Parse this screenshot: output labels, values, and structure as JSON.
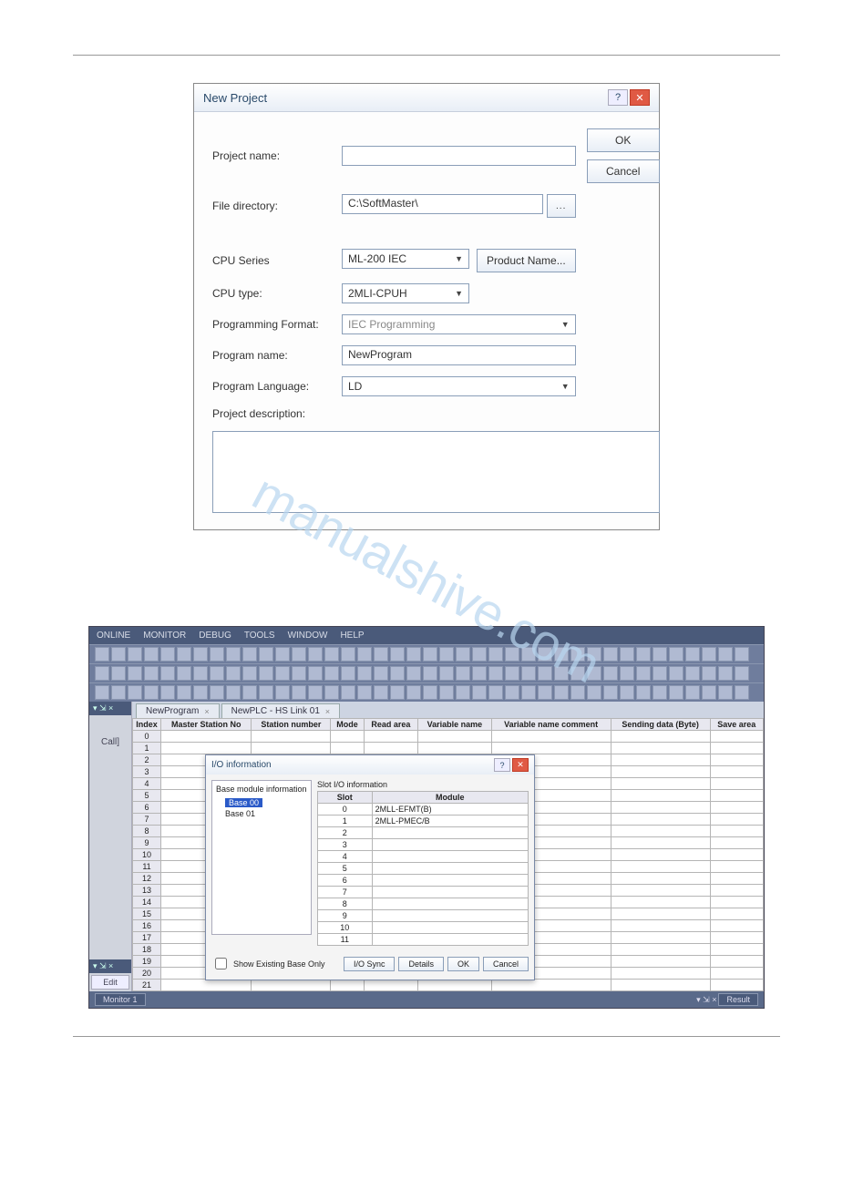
{
  "new_project": {
    "title": "New Project",
    "labels": {
      "project_name": "Project name:",
      "file_directory": "File directory:",
      "cpu_series": "CPU Series",
      "cpu_type": "CPU type:",
      "programming_format": "Programming Format:",
      "program_name": "Program name:",
      "program_language": "Program Language:",
      "project_description": "Project description:"
    },
    "values": {
      "project_name": "",
      "file_directory": "C:\\SoftMaster\\",
      "cpu_series": "ML-200 IEC",
      "cpu_type": "2MLI-CPUH",
      "programming_format": "IEC Programming",
      "program_name": "NewProgram",
      "program_language": "LD",
      "project_description": ""
    },
    "buttons": {
      "ok": "OK",
      "cancel": "Cancel",
      "product_name": "Product Name...",
      "browse": "..."
    }
  },
  "watermark": "manualshive.com",
  "app": {
    "menus": [
      "ONLINE",
      "MONITOR",
      "DEBUG",
      "TOOLS",
      "WINDOW",
      "HELP"
    ],
    "tabs": [
      {
        "label": "NewProgram"
      },
      {
        "label": "NewPLC - HS Link 01"
      }
    ],
    "side_panel_pin": "▾ ⇲ ×",
    "side_edit": "Edit",
    "call_label": "Call]",
    "grid_headers": [
      "Index",
      "Master Station No",
      "Station number",
      "Mode",
      "Read area",
      "Variable name",
      "Variable name comment",
      "Sending data (Byte)",
      "Save area"
    ],
    "grid_rows": [
      "0",
      "1",
      "2",
      "3",
      "4",
      "5",
      "6",
      "7",
      "8",
      "9",
      "10",
      "11",
      "12",
      "13",
      "14",
      "15",
      "16",
      "17",
      "18",
      "19",
      "20",
      "21"
    ],
    "io_dialog": {
      "title": "I/O information",
      "base_label": "Base module information",
      "slot_label": "Slot I/O information",
      "tree": [
        {
          "label": "Base 00",
          "selected": true
        },
        {
          "label": "Base 01",
          "selected": false
        }
      ],
      "slot_headers": [
        "Slot",
        "Module"
      ],
      "slot_rows": [
        {
          "slot": "0",
          "module": "2MLL-EFMT(B)"
        },
        {
          "slot": "1",
          "module": "2MLL-PMEC/B"
        },
        {
          "slot": "2",
          "module": ""
        },
        {
          "slot": "3",
          "module": ""
        },
        {
          "slot": "4",
          "module": ""
        },
        {
          "slot": "5",
          "module": ""
        },
        {
          "slot": "6",
          "module": ""
        },
        {
          "slot": "7",
          "module": ""
        },
        {
          "slot": "8",
          "module": ""
        },
        {
          "slot": "9",
          "module": ""
        },
        {
          "slot": "10",
          "module": ""
        },
        {
          "slot": "11",
          "module": ""
        }
      ],
      "checkbox": "Show Existing Base Only",
      "buttons": {
        "io_sync": "I/O Sync",
        "details": "Details",
        "ok": "OK",
        "cancel": "Cancel"
      }
    },
    "status": {
      "left": "Monitor 1",
      "center_pin": "▾ ⇲ ×",
      "right": "Result"
    }
  }
}
